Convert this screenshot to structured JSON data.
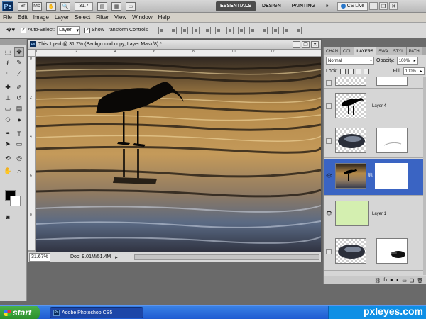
{
  "appbar": {
    "logo": "Ps",
    "zoom": "31.7",
    "workspaces": [
      "ESSENTIALS",
      "DESIGN",
      "PAINTING",
      "»"
    ],
    "cs_live": "CS Live",
    "window_controls": [
      "‒",
      "❐",
      "✕"
    ]
  },
  "menu": [
    "File",
    "Edit",
    "Image",
    "Layer",
    "Select",
    "Filter",
    "View",
    "Window",
    "Help"
  ],
  "options": {
    "auto_select_label": "Auto-Select:",
    "auto_select_value": "Layer",
    "show_transform_label": "Show Transform Controls"
  },
  "document": {
    "title": "This 1.psd @ 31.7% (Background copy, Layer Mask/8) *",
    "zoom": "31.67%",
    "doc_size": "Doc: 9.01M/51.4M",
    "ruler_top": [
      "0",
      "2",
      "4",
      "6",
      "8",
      "10",
      "12"
    ],
    "ruler_left": [
      "0",
      "2",
      "4",
      "6",
      "8"
    ]
  },
  "layers_panel": {
    "tabs": [
      "CHAN",
      "COL",
      "LAYERS",
      "SWA",
      "STYL",
      "PATH"
    ],
    "active_tab": "LAYERS",
    "blend_mode": "Normal",
    "opacity_label": "Opacity:",
    "opacity": "100%",
    "lock_label": "Lock:",
    "fill_label": "Fill:",
    "fill": "100%",
    "layers": [
      {
        "name": "",
        "visible": false
      },
      {
        "name": "Layer 4",
        "visible": false
      },
      {
        "name": "",
        "visible": false
      },
      {
        "name": "",
        "visible": true,
        "selected": true
      },
      {
        "name": "Layer 1",
        "visible": true
      },
      {
        "name": "",
        "visible": false
      }
    ]
  },
  "taskbar": {
    "start": "start",
    "task": "Adobe Photoshop CS5",
    "watermark": "pxleyes.com"
  },
  "colors": {
    "selection": "#3a64c3",
    "layer1_fill": "#d4efb0"
  }
}
